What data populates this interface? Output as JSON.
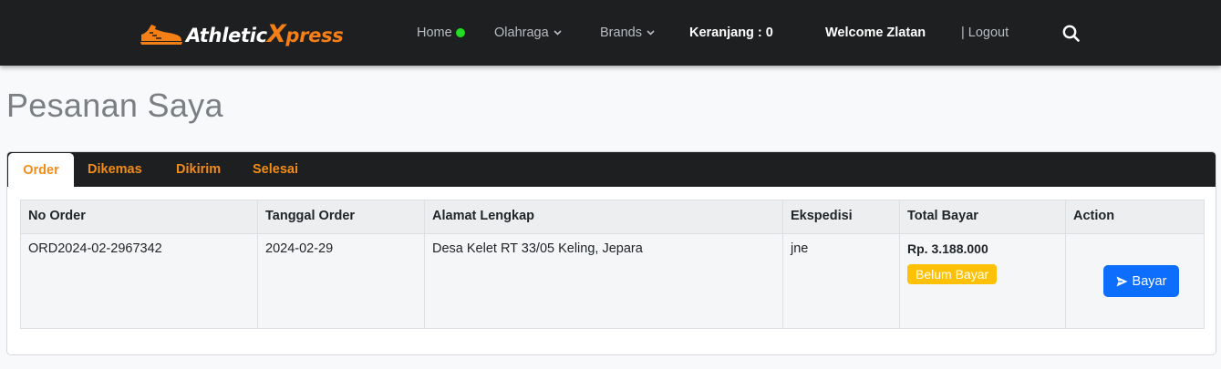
{
  "brand": {
    "part1": "Athletic",
    "part2": "X",
    "part3": "press",
    "icon": "sneaker-icon"
  },
  "nav": {
    "home": "Home",
    "olahraga": "Olahraga",
    "brands": "Brands",
    "cart": "Keranjang : 0",
    "welcome": "Welcome Zlatan",
    "logout": "| Logout",
    "search_icon": "search-icon"
  },
  "page": {
    "title": "Pesanan Saya"
  },
  "tabs": [
    "Order",
    "Dikemas",
    "Dikirim",
    "Selesai"
  ],
  "table": {
    "headers": [
      "No Order",
      "Tanggal Order",
      "Alamat Lengkap",
      "Ekspedisi",
      "Total Bayar",
      "Action"
    ],
    "rows": [
      {
        "no_order": "ORD2024-02-2967342",
        "tanggal": "2024-02-29",
        "alamat": "Desa Kelet RT 33/05 Keling, Jepara",
        "ekspedisi": "jne",
        "total": "Rp. 3.188.000",
        "status": "Belum Bayar",
        "action": "Bayar"
      }
    ]
  },
  "colors": {
    "accent": "#f28c18",
    "nav_bg": "#1e1f21",
    "primary": "#0d6efd",
    "warning": "#ffc107",
    "online": "#22dd22"
  }
}
